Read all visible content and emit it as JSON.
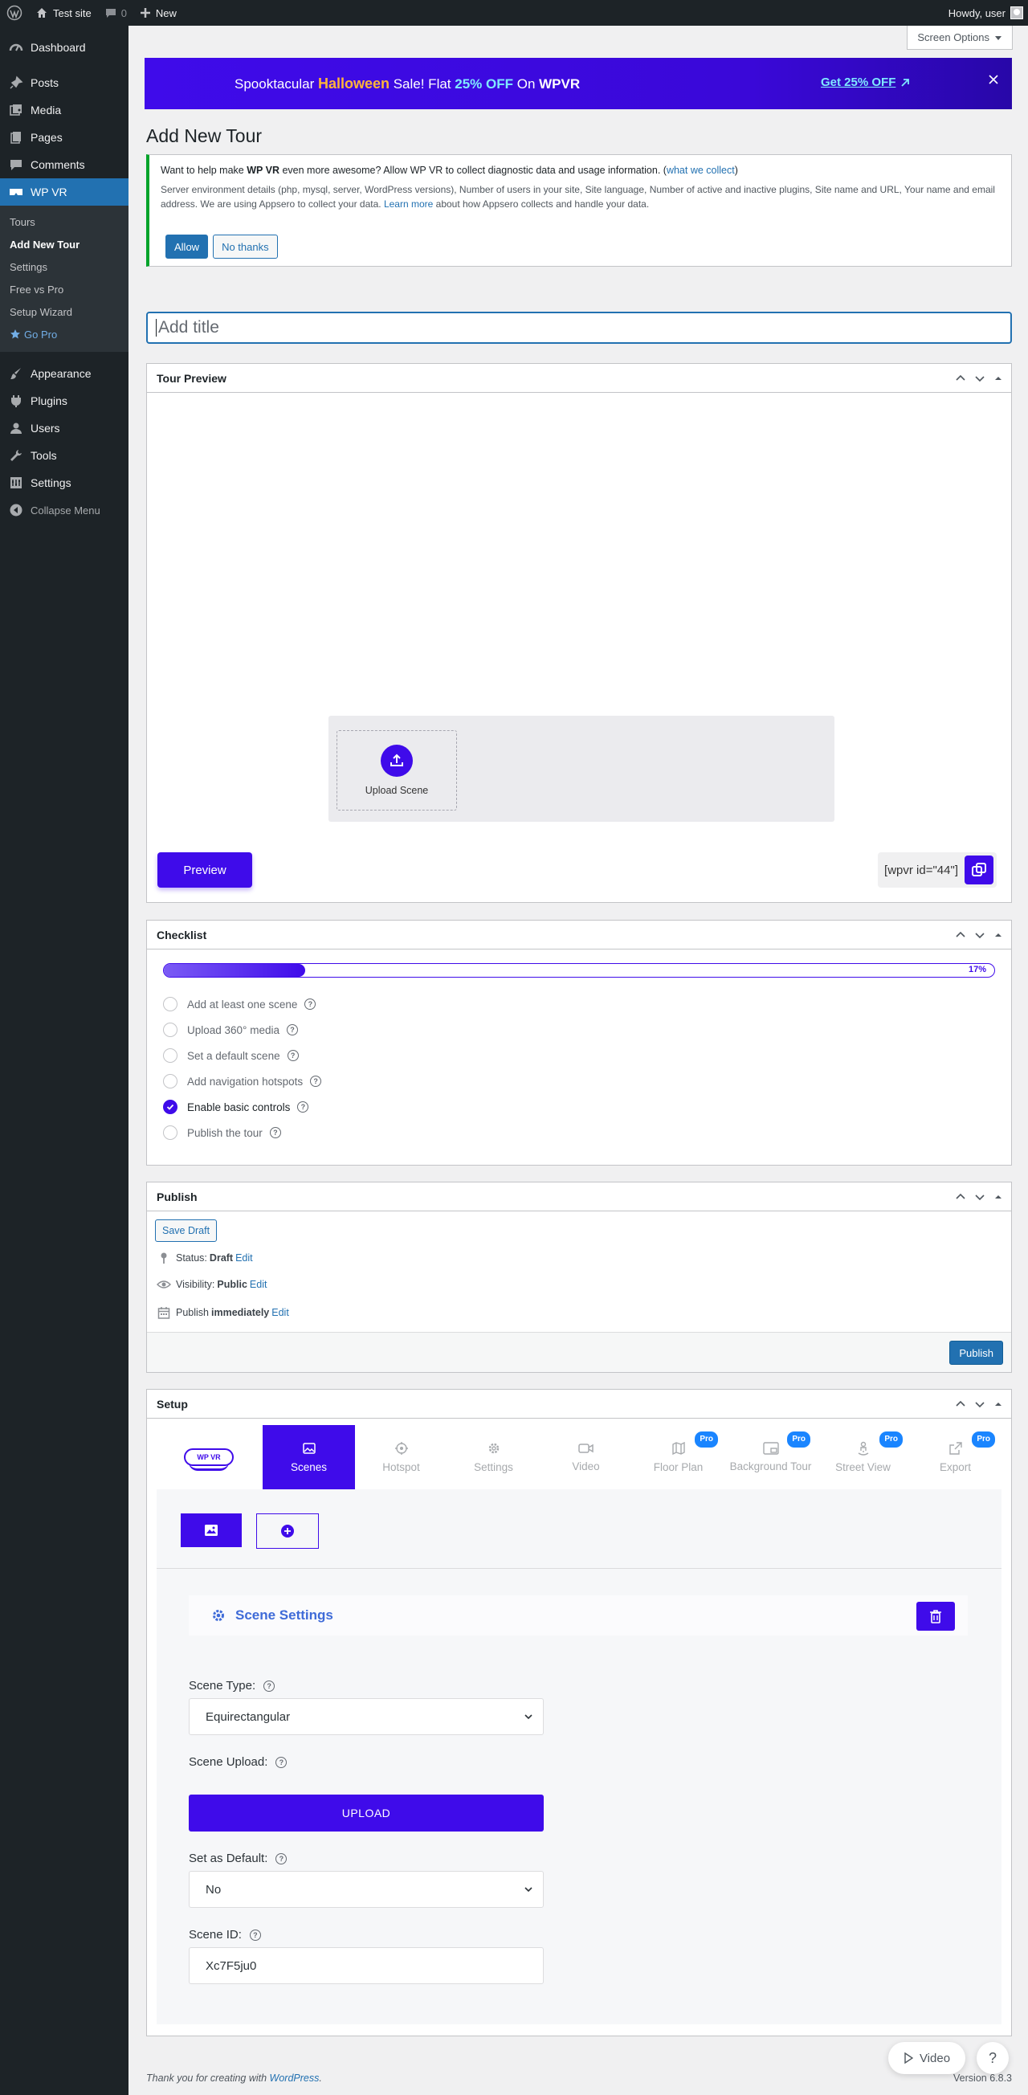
{
  "adminbar": {
    "site_name": "Test site",
    "comments_count": "0",
    "new_label": "New",
    "howdy": "Howdy, user"
  },
  "sidebar": {
    "items_top": [
      {
        "label": "Dashboard",
        "icon": "dashboard-icon"
      },
      {
        "label": "Posts",
        "icon": "pin-icon"
      },
      {
        "label": "Media",
        "icon": "media-icon"
      },
      {
        "label": "Pages",
        "icon": "pages-icon"
      },
      {
        "label": "Comments",
        "icon": "comment-icon"
      },
      {
        "label": "WP VR",
        "icon": "vr-icon"
      }
    ],
    "submenu": [
      "Tours",
      "Add New Tour",
      "Settings",
      "Free vs Pro",
      "Setup Wizard",
      "Go Pro"
    ],
    "items_bottom": [
      {
        "label": "Appearance",
        "icon": "brush-icon"
      },
      {
        "label": "Plugins",
        "icon": "plugin-icon"
      },
      {
        "label": "Users",
        "icon": "users-icon"
      },
      {
        "label": "Tools",
        "icon": "wrench-icon"
      },
      {
        "label": "Settings",
        "icon": "settings-icon"
      }
    ],
    "collapse": "Collapse Menu"
  },
  "screen_options": "Screen Options",
  "promo": {
    "p1": "Spooktacular ",
    "p2": "Halloween",
    "p3": " Sale!   Flat ",
    "p4": "25% OFF",
    "p5": " On ",
    "p6": "WPVR",
    "link": "Get 25% OFF"
  },
  "page_title": "Add New Tour",
  "notice": {
    "line1_a": "Want to help make ",
    "line1_b": "WP VR",
    "line1_c": " even more awesome? Allow WP VR to collect diagnostic data and usage information. (",
    "line1_link": "what we collect",
    "line1_d": ")",
    "detail_a": "Server environment details (php, mysql, server, WordPress versions), Number of users in your site, Site language, Number of active and inactive plugins, Site name and URL, Your name and email address. We are using Appsero to collect your data. ",
    "detail_link": "Learn more",
    "detail_b": " about how Appsero collects and handle your data.",
    "allow": "Allow",
    "no_thanks": "No thanks"
  },
  "title_placeholder": "Add title",
  "tour_preview": {
    "heading": "Tour Preview",
    "upload_scene": "Upload Scene",
    "preview": "Preview",
    "shortcode": "[wpvr id=\"44\"]"
  },
  "checklist": {
    "heading": "Checklist",
    "percent_label": "17%",
    "progress": 0.17,
    "items": [
      {
        "label": "Add at least one scene",
        "done": false
      },
      {
        "label": "Upload 360° media",
        "done": false
      },
      {
        "label": "Set a default scene",
        "done": false
      },
      {
        "label": "Add navigation hotspots",
        "done": false
      },
      {
        "label": "Enable basic controls",
        "done": true
      },
      {
        "label": "Publish the tour",
        "done": false
      }
    ]
  },
  "publish": {
    "heading": "Publish",
    "save_draft": "Save Draft",
    "status_label": "Status:",
    "status_value": "Draft",
    "visibility_label": "Visibility:",
    "visibility_value": "Public",
    "publish_label": "Publish",
    "publish_value": "immediately",
    "edit": "Edit",
    "publish_button": "Publish"
  },
  "setup": {
    "heading": "Setup",
    "logo": "WP VR",
    "tabs": [
      {
        "label": "Scenes",
        "icon": "image-icon",
        "active": true,
        "pro": false
      },
      {
        "label": "Hotspot",
        "icon": "target-icon",
        "active": false,
        "pro": false
      },
      {
        "label": "Settings",
        "icon": "gear-icon",
        "active": false,
        "pro": false
      },
      {
        "label": "Video",
        "icon": "video-icon",
        "active": false,
        "pro": false
      },
      {
        "label": "Floor Plan",
        "icon": "map-icon",
        "active": false,
        "pro": true
      },
      {
        "label": "Background Tour",
        "icon": "picture-in-picture-icon",
        "active": false,
        "pro": true
      },
      {
        "label": "Street View",
        "icon": "person-pin-icon",
        "active": false,
        "pro": true
      },
      {
        "label": "Export",
        "icon": "export-icon",
        "active": false,
        "pro": true
      }
    ],
    "pro_badge": "Pro",
    "scene_settings": "Scene Settings",
    "scene_type_label": "Scene Type:",
    "scene_type_value": "Equirectangular",
    "scene_upload_label": "Scene Upload:",
    "upload_button": "UPLOAD",
    "default_label": "Set as Default:",
    "default_value": "No",
    "scene_id_label": "Scene ID:",
    "scene_id_value": "Xc7F5ju0"
  },
  "footer": {
    "thanks_a": "Thank you for creating with ",
    "thanks_link": "WordPress",
    "thanks_b": ".",
    "version": "Version 6.8.3",
    "video": "Video",
    "help": "?"
  },
  "colors": {
    "brand": "#3f0bea",
    "wp_blue": "#2271b1",
    "sidebar": "#1d2327"
  }
}
